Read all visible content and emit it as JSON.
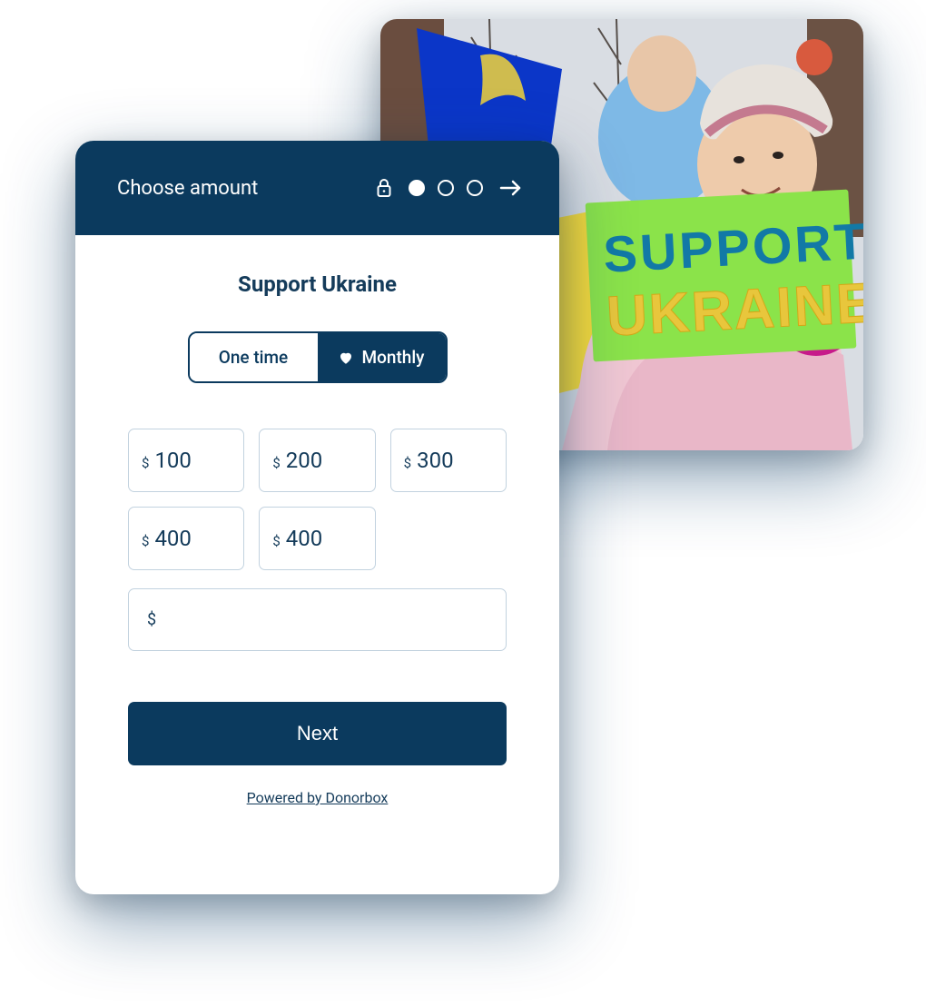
{
  "header": {
    "title": "Choose amount",
    "steps_total": 3,
    "active_step": 1
  },
  "campaign": {
    "title": "Support Ukraine"
  },
  "frequency": {
    "one_time_label": "One time",
    "monthly_label": "Monthly",
    "selected": "monthly"
  },
  "currency_symbol": "$",
  "amounts": [
    "100",
    "200",
    "300",
    "400",
    "400"
  ],
  "custom_amount": {
    "value": "",
    "placeholder": ""
  },
  "next_label": "Next",
  "footer": {
    "powered_by": "Powered by Donorbox"
  },
  "photo": {
    "sign_line1": "SUPPORT",
    "sign_line2": "UKRAINE"
  },
  "colors": {
    "brand_dark": "#0b3a5e",
    "text_dark": "#143b5a",
    "border_light": "#c2d2df"
  }
}
